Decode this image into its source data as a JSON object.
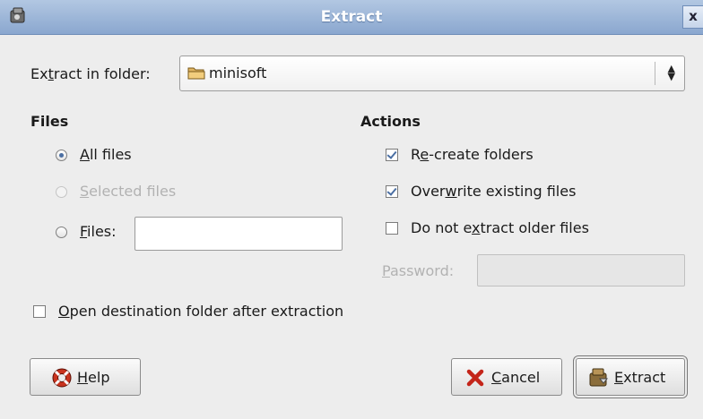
{
  "window": {
    "title": "Extract",
    "close_glyph": "x"
  },
  "folder": {
    "label_pre": "Ex",
    "label_mn": "t",
    "label_post": "ract in folder:",
    "value": "minisoft"
  },
  "files": {
    "heading": "Files",
    "all": {
      "mn": "A",
      "rest": "ll files",
      "checked": true
    },
    "selected": {
      "mn": "S",
      "rest": "elected files",
      "enabled": false
    },
    "files": {
      "mn": "F",
      "rest": "iles:",
      "input_value": ""
    }
  },
  "actions": {
    "heading": "Actions",
    "recreate": {
      "pre": "R",
      "mn": "e",
      "post": "-create folders",
      "checked": true
    },
    "overwrite": {
      "pre": "Over",
      "mn": "w",
      "post": "rite existing files",
      "checked": true
    },
    "older": {
      "pre": "Do not e",
      "mn": "x",
      "post": "tract older files",
      "checked": false
    },
    "password": {
      "mn": "P",
      "rest": "assword:",
      "value": "",
      "enabled": false
    }
  },
  "open_dest": {
    "mn": "O",
    "rest": "pen destination folder after extraction",
    "checked": false
  },
  "buttons": {
    "help": {
      "mn": "H",
      "rest": "elp"
    },
    "cancel": {
      "mn": "C",
      "rest": "ancel"
    },
    "extract": {
      "mn": "E",
      "rest": "xtract"
    }
  }
}
